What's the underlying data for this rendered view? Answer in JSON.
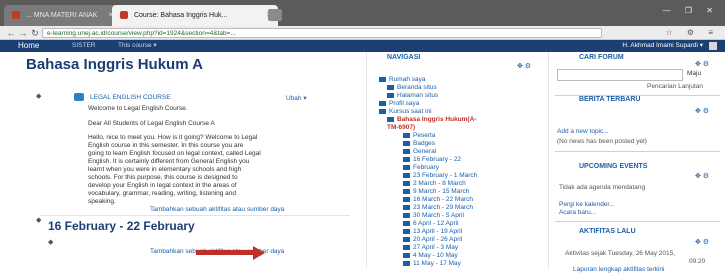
{
  "browser": {
    "tab_inactive": "... MNA MATERI ANAK",
    "tab_active": "Course: Bahasa Inggris Huk...",
    "url": "e-learning.unej.ac.id/course/view.php?id=1924&section=4&tab=..."
  },
  "header": {
    "home": "Home",
    "nav1": "SISTER",
    "nav2": "This course ▾",
    "user": "H. Akhmad Imami Supardi ▾"
  },
  "main": {
    "course_title": "Bahasa Inggris Hukum A",
    "forum_link": "LEGAL ENGLISH COURSE",
    "ubah": "Ubah ▾",
    "welcome": "Welcome to Legal English Course.",
    "dear": "Dear All Students of Legal English Course A",
    "para": [
      "Hello, nice to meet you. How is it going? Welcome to Legal",
      "English course in this semester. In this course you are",
      "going to learn English focused on legal context, called Legal",
      "English. It is certainly different from General English you",
      "learnt when you were in elementary schools and high",
      "schools. For this purpose, this course is designed to",
      "develop your English in legal context in the areas of",
      "vocabulary, grammar, reading, writing, listening and",
      "speaking."
    ],
    "add_activity": "Tambahkan sebuah aktifitas atau sumber daya",
    "section2_title": "16 February - 22 February",
    "add_activity2": "Tambahkan sebuah aktifitas atau sumber daya"
  },
  "navigation": {
    "title": "NAVIGASI",
    "items": [
      {
        "label": "Rumah saya",
        "level": 0,
        "current": false
      },
      {
        "label": "Beranda situs",
        "level": 1,
        "current": false
      },
      {
        "label": "Halaman situs",
        "level": 1,
        "current": false
      },
      {
        "label": "Profil saya",
        "level": 0,
        "current": false
      },
      {
        "label": "Kursus saat ini",
        "level": 0,
        "current": false
      },
      {
        "label": "Bahasa Inggris Hukum(A-",
        "level": 1,
        "current": true
      },
      {
        "label": "TM-6907)",
        "level": 1,
        "current": true
      },
      {
        "label": "Peserta",
        "level": 2,
        "current": false
      },
      {
        "label": "Badges",
        "level": 2,
        "current": false
      },
      {
        "label": "General",
        "level": 2,
        "current": false
      },
      {
        "label": "16 February - 22",
        "level": 2,
        "current": false
      },
      {
        "label": "February",
        "level": 2,
        "current": false
      },
      {
        "label": "23 February - 1 March",
        "level": 2,
        "current": false
      },
      {
        "label": "2 March - 8 March",
        "level": 2,
        "current": false
      },
      {
        "label": "9 March - 15 March",
        "level": 2,
        "current": false
      },
      {
        "label": "16 March - 22 March",
        "level": 2,
        "current": false
      },
      {
        "label": "23 March - 29 March",
        "level": 2,
        "current": false
      },
      {
        "label": "30 March - 5 April",
        "level": 2,
        "current": false
      },
      {
        "label": "6 April - 12 April",
        "level": 2,
        "current": false
      },
      {
        "label": "13 April - 19 April",
        "level": 2,
        "current": false
      },
      {
        "label": "20 April - 26 April",
        "level": 2,
        "current": false
      },
      {
        "label": "27 April - 3 May",
        "level": 2,
        "current": false
      },
      {
        "label": "4 May - 10 May",
        "level": 2,
        "current": false
      },
      {
        "label": "11 May - 17 May",
        "level": 2,
        "current": false
      }
    ]
  },
  "right": {
    "search_title": "CARI FORUM",
    "search_go": "Maju",
    "advanced": "Pencarian Lanjutan",
    "news_title": "BERITA TERBARU",
    "add_topic": "Add a new topic...",
    "no_news": "(No news has been posted yet)",
    "events_title": "UPCOMING EVENTS",
    "no_events": "Tidak ada agenda mendatang",
    "go_calendar": "Pergi ke kalender...",
    "new_event": "Acara baru...",
    "activity_title": "AKTIFITAS LALU",
    "activity_since": "Aktivitas sejak Tuesday, 26 May 2015,",
    "activity_time": "09:20",
    "full_report": "Laporan lengkap aktifitas terkini"
  }
}
